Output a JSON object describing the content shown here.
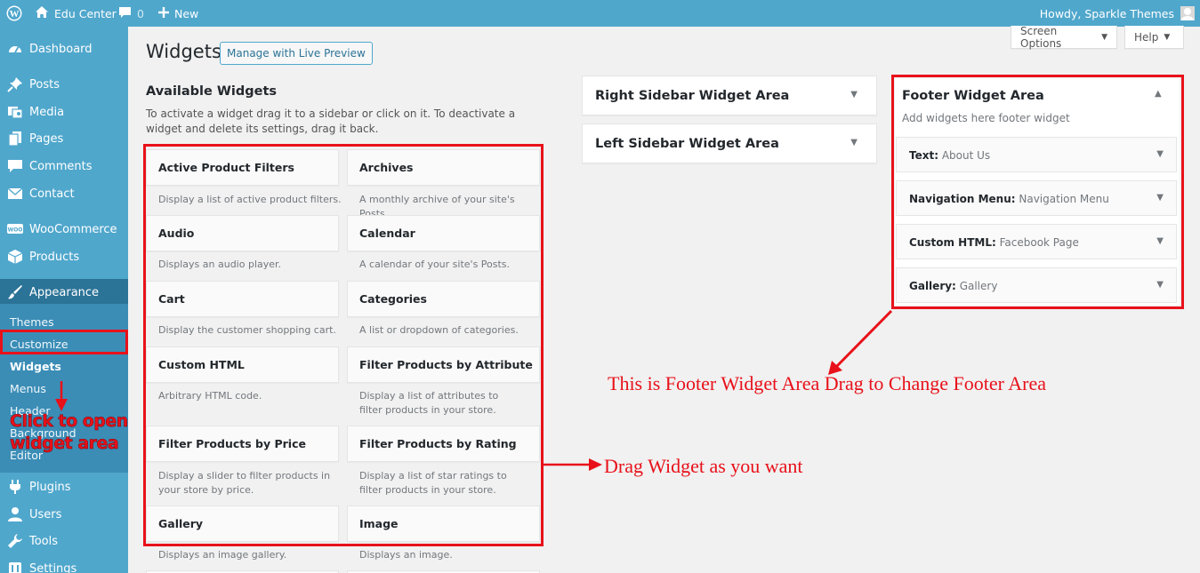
{
  "adminbar": {
    "site_name": "Edu Center",
    "comments_count": "0",
    "new_label": "New",
    "howdy": "Howdy, Sparkle Themes"
  },
  "menu": {
    "dashboard": "Dashboard",
    "posts": "Posts",
    "media": "Media",
    "pages": "Pages",
    "comments": "Comments",
    "contact": "Contact",
    "woocommerce": "WooCommerce",
    "products": "Products",
    "appearance": "Appearance",
    "plugins": "Plugins",
    "users": "Users",
    "tools": "Tools",
    "settings": "Settings",
    "woo_badge": "WOO"
  },
  "submenu": {
    "themes": "Themes",
    "customize": "Customize",
    "widgets": "Widgets",
    "menus": "Menus",
    "header": "Header",
    "background": "Background",
    "editor": "Editor"
  },
  "page": {
    "title": "Widgets",
    "live_preview": "Manage with Live Preview",
    "screen_options": "Screen Options",
    "help": "Help"
  },
  "available": {
    "title": "Available Widgets",
    "description": "To activate a widget drag it to a sidebar or click on it. To deactivate a widget and delete its settings, drag it back.",
    "widgets": [
      {
        "name": "Active Product Filters",
        "desc": "Display a list of active product filters."
      },
      {
        "name": "Archives",
        "desc": "A monthly archive of your site's Posts."
      },
      {
        "name": "Audio",
        "desc": "Displays an audio player."
      },
      {
        "name": "Calendar",
        "desc": "A calendar of your site's Posts."
      },
      {
        "name": "Cart",
        "desc": "Display the customer shopping cart."
      },
      {
        "name": "Categories",
        "desc": "A list or dropdown of categories."
      },
      {
        "name": "Custom HTML",
        "desc": "Arbitrary HTML code."
      },
      {
        "name": "Filter Products by Attribute",
        "desc": "Display a list of attributes to filter products in your store."
      },
      {
        "name": "Filter Products by Price",
        "desc": "Display a slider to filter products in your store by price."
      },
      {
        "name": "Filter Products by Rating",
        "desc": "Display a list of star ratings to filter products in your store."
      },
      {
        "name": "Gallery",
        "desc": "Displays an image gallery."
      },
      {
        "name": "Image",
        "desc": "Displays an image."
      }
    ]
  },
  "sidebars": {
    "right": "Right Sidebar Widget Area",
    "left": "Left Sidebar Widget Area"
  },
  "footer_area": {
    "title": "Footer Widget Area",
    "description": "Add widgets here footer widget",
    "widgets": [
      {
        "type": "Text:",
        "instance": "About Us"
      },
      {
        "type": "Navigation Menu:",
        "instance": "Navigation Menu"
      },
      {
        "type": "Custom HTML:",
        "instance": "Facebook Page"
      },
      {
        "type": "Gallery:",
        "instance": "Gallery"
      }
    ]
  },
  "annotations": {
    "footer_note": "This is Footer Widget Area Drag to Change Footer Area",
    "drag_note": "Drag Widget as you want",
    "click_note": "Click to open widget area"
  },
  "colors": {
    "admin_blue": "#50a7cc",
    "active_menu": "#2b7397",
    "annotation_red": "#e8111a"
  }
}
